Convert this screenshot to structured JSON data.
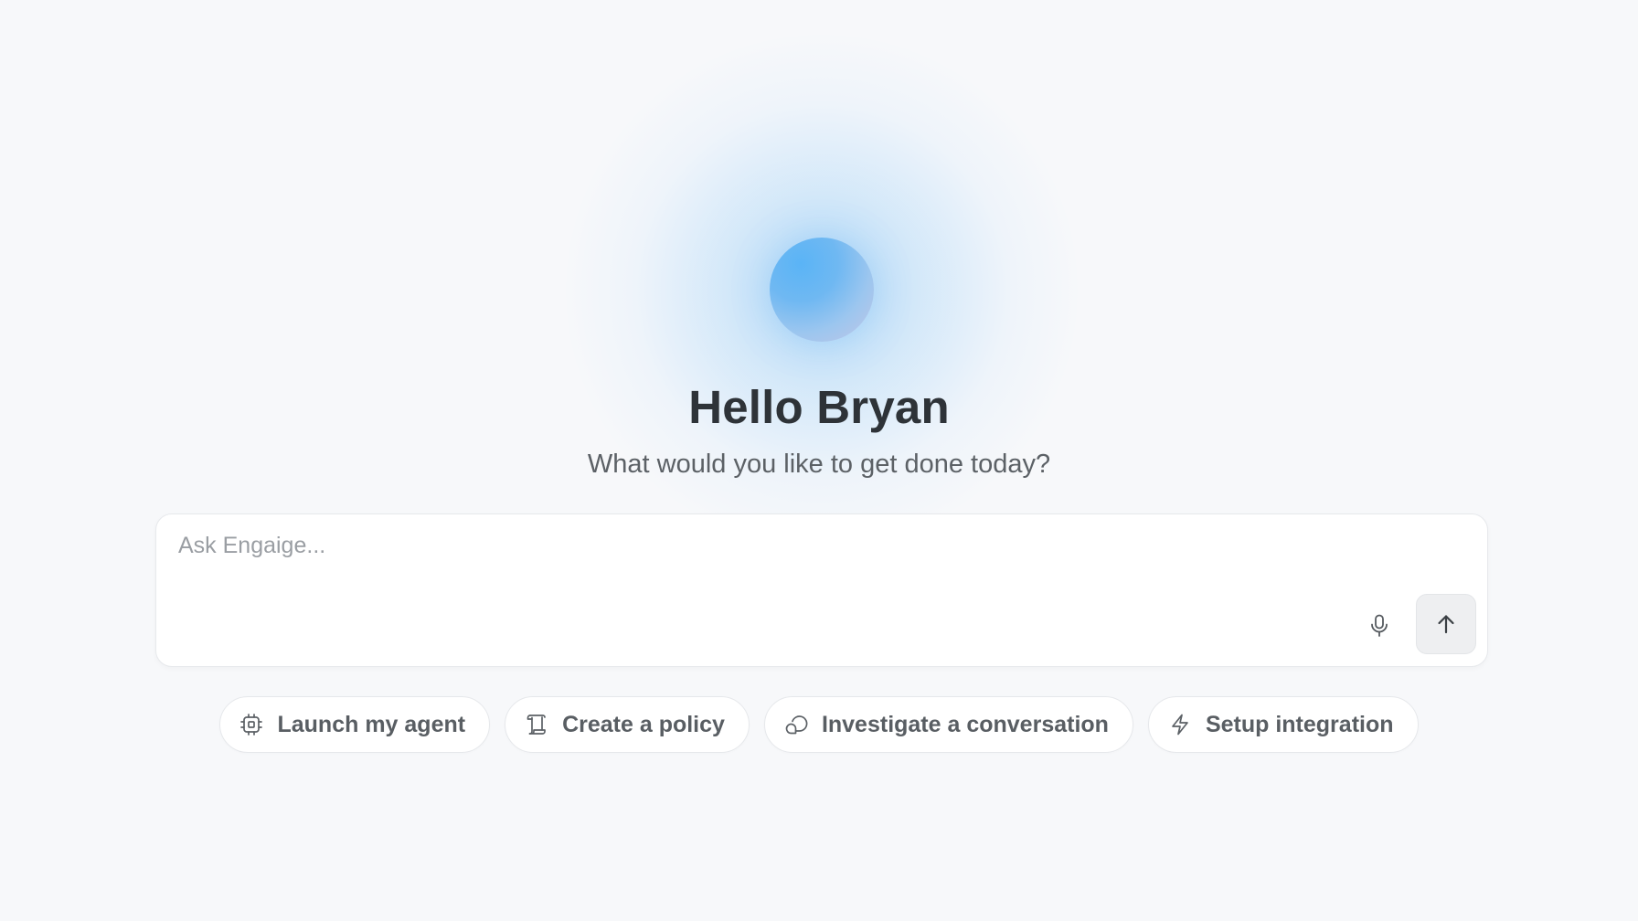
{
  "greeting": {
    "title": "Hello Bryan",
    "subtitle": "What would you like to get done today?"
  },
  "composer": {
    "placeholder": "Ask Engaige...",
    "value": "",
    "mic_icon": "microphone-icon",
    "send_icon": "arrow-up-icon"
  },
  "suggestions": [
    {
      "label": "Launch my agent",
      "icon": "chip-icon"
    },
    {
      "label": "Create a policy",
      "icon": "scroll-icon"
    },
    {
      "label": "Investigate a conversation",
      "icon": "chat-bubble-icon"
    },
    {
      "label": "Setup integration",
      "icon": "lightning-icon"
    }
  ],
  "colors": {
    "background": "#f7f8fa",
    "orb": "#5ab4f6",
    "title": "#2e3338",
    "subtitle": "#5c6166"
  }
}
